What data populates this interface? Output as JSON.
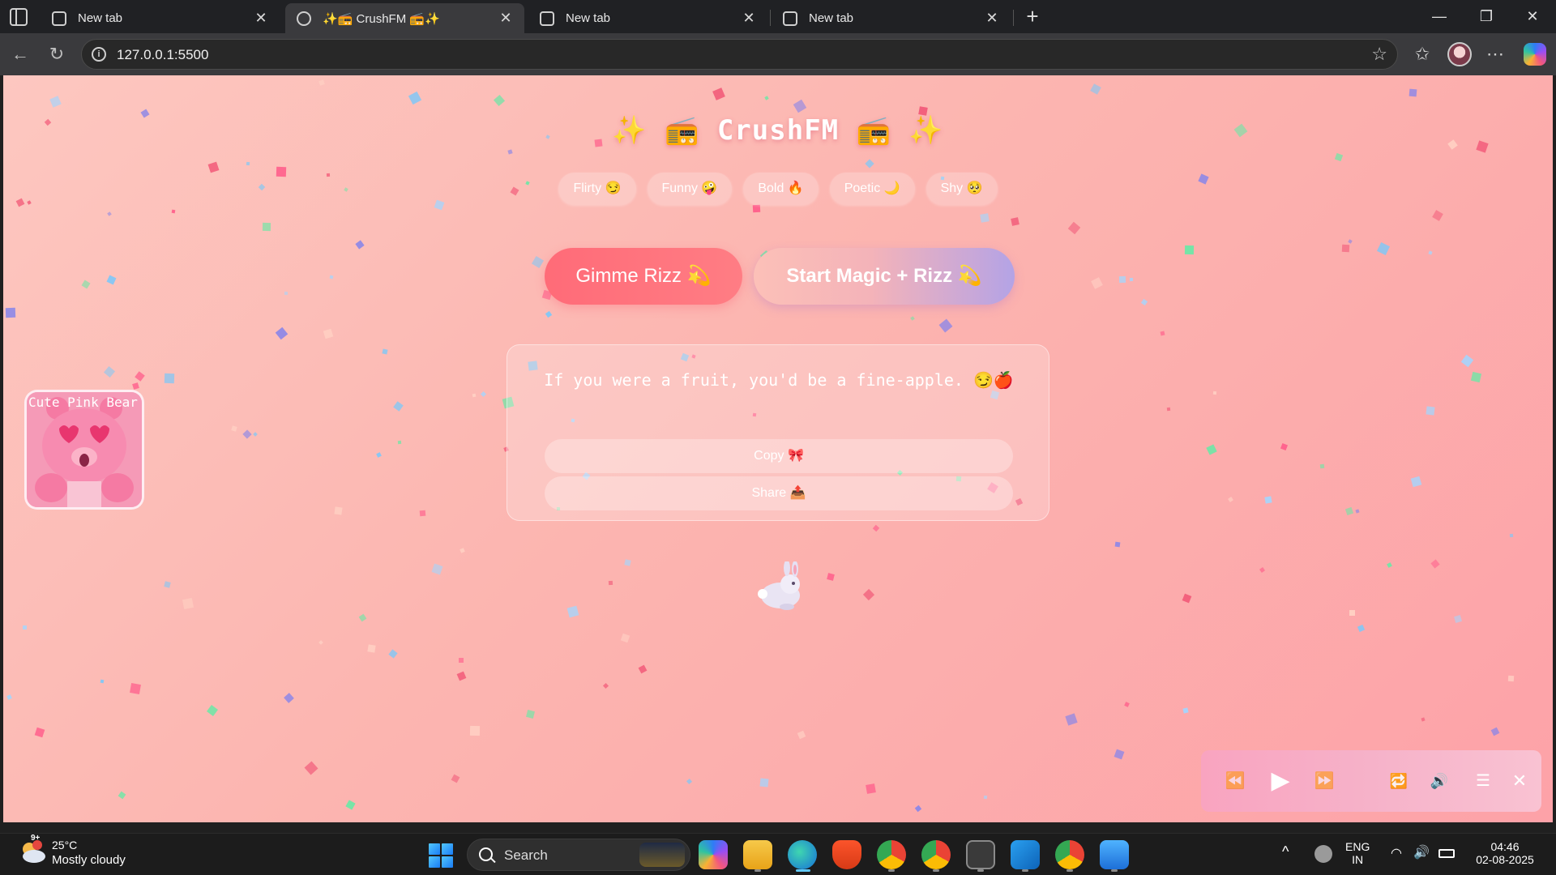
{
  "browser": {
    "tabs": [
      {
        "title": "New tab",
        "active": false
      },
      {
        "title": "✨📻 CrushFM 📻✨",
        "active": true
      },
      {
        "title": "New tab",
        "active": false
      },
      {
        "title": "New tab",
        "active": false
      }
    ],
    "tab_close_glyph": "✕",
    "new_tab_glyph": "+",
    "window_controls": {
      "minimize": "—",
      "maximize": "❐",
      "close": "✕"
    },
    "address": "127.0.0.1:5500"
  },
  "page": {
    "title": "✨ 📻 CrushFM 📻 ✨",
    "moods": [
      "Flirty 😏",
      "Funny 🤪",
      "Bold 🔥",
      "Poetic 🌙",
      "Shy 🥺"
    ],
    "gimme_button": "Gimme Rizz 💫",
    "magic_button": "Start Magic + Rizz 💫",
    "line": "If you were a fruit, you'd be a fine-apple. 😏🍎",
    "copy_button": "Copy 🎀",
    "share_button": "Share 📤",
    "bear_alt": "Cute Pink Bear",
    "bunny": "🐇"
  },
  "player": {
    "rewind": "⏪",
    "play": "▶",
    "forward": "⏩",
    "repeat": "🔁",
    "volume": "🔊",
    "playlist": "☰",
    "close": "✕"
  },
  "taskbar": {
    "weather": {
      "badge": "9+",
      "temp": "25°C",
      "desc": "Mostly cloudy"
    },
    "search_label": "Search",
    "language": {
      "line1": "ENG",
      "line2": "IN"
    },
    "time": "04:46",
    "date": "02-08-2025",
    "tray_up": "^"
  },
  "colors": {
    "page_bg_start": "#fdc7c0",
    "page_bg_end": "#fda2a8",
    "gimme_btn": "#ff6b78",
    "magic_btn_end": "#b3a3e6",
    "player_bg": "#f6b2c9"
  }
}
